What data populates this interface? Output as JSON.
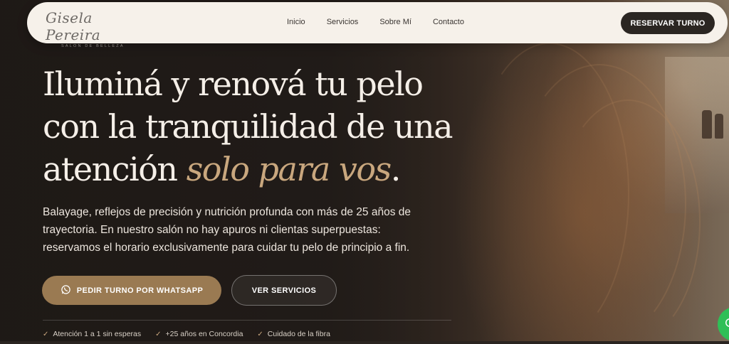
{
  "brand": {
    "name": "Gisela Pereira",
    "tagline": "SALON DE BELLEZA"
  },
  "nav": {
    "items": [
      "Inicio",
      "Servicios",
      "Sobre Mí",
      "Contacto"
    ],
    "cta": "RESERVAR TURNO"
  },
  "hero": {
    "headline_line1": "Iluminá y renová tu pelo",
    "headline_line2": "con la tranquilidad de una",
    "headline_line3_start": "atención ",
    "headline_accent": "solo para vos",
    "headline_end": ".",
    "lead": "Balayage, reflejos de precisión y nutrición profunda con más de 25 años de trayectoria. En nuestro salón no hay apuros ni clientas superpuestas: reservamos el horario exclusivamente para cuidar tu pelo de principio a fin.",
    "primary_button": "PEDIR TURNO POR WHATSAPP",
    "secondary_button": "VER SERVICIOS",
    "features": [
      "Atención 1 a 1 sin esperas",
      "+25 años en Concordia",
      "Cuidado de la fibra"
    ]
  },
  "colors": {
    "accent": "#c9a77e",
    "primary_button": "#9a7a52",
    "nav_bg": "#f6f1ea",
    "dark": "#2b2622",
    "whatsapp": "#2fbf57"
  },
  "icons": [
    "whatsapp-icon",
    "check-icon",
    "whatsapp-float-icon"
  ]
}
